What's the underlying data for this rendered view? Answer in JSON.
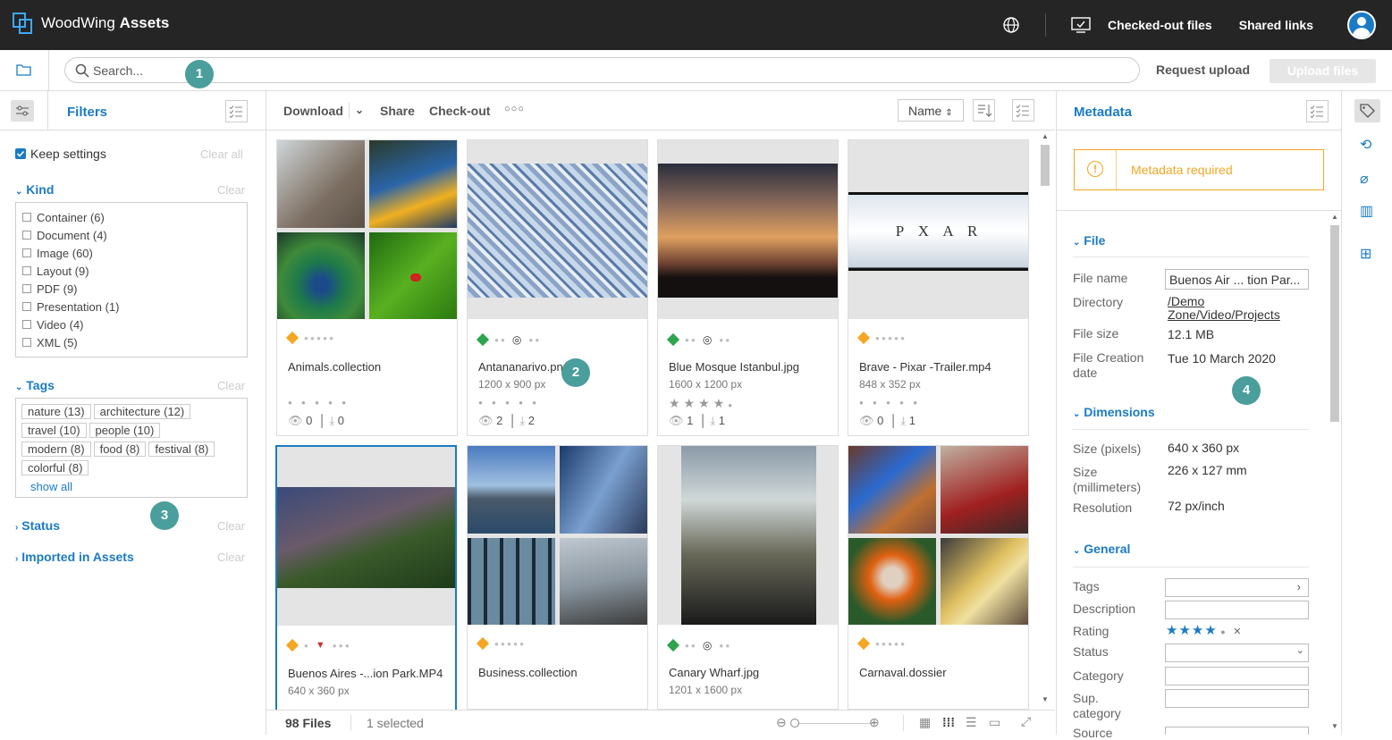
{
  "app": {
    "brand_light": "WoodWing",
    "brand_bold": "Assets"
  },
  "topnav": {
    "checked_out": "Checked-out files",
    "shared": "Shared links"
  },
  "search": {
    "placeholder": "Search...",
    "request_upload": "Request upload",
    "upload_files": "Upload files"
  },
  "badges": [
    "1",
    "2",
    "3",
    "4"
  ],
  "filters": {
    "title": "Filters",
    "keep": "Keep settings",
    "clear_all": "Clear all",
    "clear": "Clear",
    "kind_title": "Kind",
    "kinds": [
      "Container (6)",
      "Document (4)",
      "Image (60)",
      "Layout (9)",
      "PDF (9)",
      "Presentation (1)",
      "Video (4)",
      "XML (5)"
    ],
    "tags_title": "Tags",
    "tags": [
      "nature (13)",
      "architecture (12)",
      "travel (10)",
      "people (10)",
      "modern (8)",
      "food (8)",
      "festival (8)",
      "colorful (8)"
    ],
    "show_all": "show all",
    "status": "Status",
    "imported": "Imported in Assets"
  },
  "toolbar": {
    "download": "Download",
    "share": "Share",
    "checkout": "Check-out",
    "more": "○○○",
    "sort": "Name"
  },
  "cards": [
    {
      "name": "Animals.collection",
      "dim": "",
      "views": "0",
      "downloads": "0",
      "tag_color": "#f5a623"
    },
    {
      "name": "Antananarivo.png",
      "dim": "1200 x 900 px",
      "views": "2",
      "downloads": "2",
      "tag_color": "#2ea44f"
    },
    {
      "name": "Blue Mosque Istanbul.jpg",
      "dim": "1600 x 1200 px",
      "views": "1",
      "downloads": "1",
      "tag_color": "#2ea44f"
    },
    {
      "name": "Brave - Pixar -Trailer.mp4",
      "dim": "848 x 352 px",
      "views": "0",
      "downloads": "1",
      "tag_color": "#f5a623"
    },
    {
      "name": "Buenos Aires -...ion Park.MP4",
      "dim": "640 x 360 px",
      "views": "",
      "downloads": "",
      "tag_color": "#f5a623"
    },
    {
      "name": "Business.collection",
      "dim": "",
      "views": "",
      "downloads": "",
      "tag_color": "#f5a623"
    },
    {
      "name": "Canary Wharf.jpg",
      "dim": "1201 x 1600 px",
      "views": "",
      "downloads": "",
      "tag_color": "#2ea44f"
    },
    {
      "name": "Carnaval.dossier",
      "dim": "",
      "views": "",
      "downloads": "",
      "tag_color": "#f5a623"
    }
  ],
  "pixar_text": "P  X A R",
  "statusbar": {
    "files": "98 Files",
    "selected": "1 selected"
  },
  "metadata": {
    "title": "Metadata",
    "required": "Metadata required",
    "file_section": "File",
    "file_name_label": "File name",
    "file_name_value": "Buenos Air ... tion Par...",
    "directory_label": "Directory",
    "directory_value1": "/Demo",
    "directory_value2": "Zone/Video/Projects",
    "file_size_label": "File size",
    "file_size_value": "12.1 MB",
    "creation_label1": "File Creation",
    "creation_label2": "date",
    "creation_value": "Tue 10 March 2020",
    "dimensions_section": "Dimensions",
    "size_px_label": "Size (pixels)",
    "size_px_value": "640 x 360 px",
    "size_mm_label1": "Size",
    "size_mm_label2": "(millimeters)",
    "size_mm_value": "226 x 127 mm",
    "resolution_label": "Resolution",
    "resolution_value": "72 px/inch",
    "general_section": "General",
    "tags_label": "Tags",
    "description_label": "Description",
    "rating_label": "Rating",
    "rating_value": 4,
    "status_label": "Status",
    "category_label": "Category",
    "sup_label1": "Sup.",
    "sup_label2": "category",
    "source_label": "Source"
  }
}
